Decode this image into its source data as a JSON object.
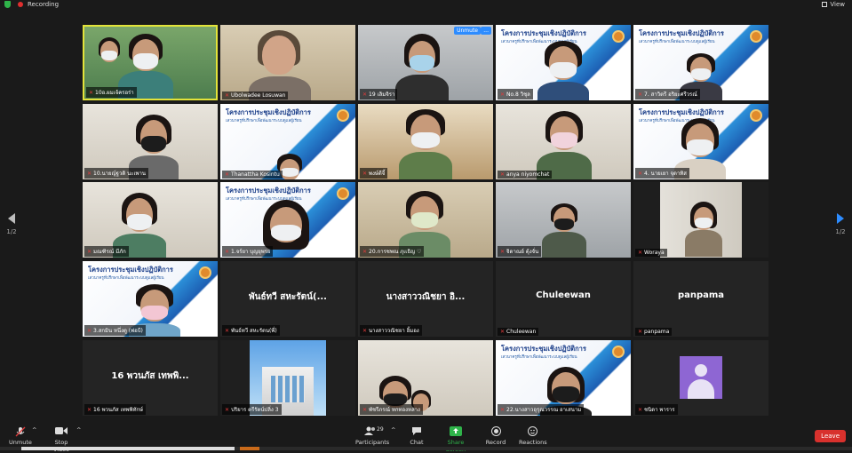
{
  "topbar": {
    "recording_label": "Recording",
    "view_label": "View"
  },
  "poster": {
    "title": "โครงการประชุมเชิงปฏิบัติการ",
    "subtitle": "เสวนาครูที่ปรึกษาเพื่อพัฒนาระบบดูแลผู้เรียน"
  },
  "tiles": {
    "t1": "10อ.ผมเจ้ครอร่า",
    "t2": "Ubolwadee Losuwan",
    "t3": "19 เลิมจิรา",
    "t4": "No.8 วิชุล",
    "t5": "7. สาวิตรี อริยะศรีวรณ์",
    "t6": "10.นายญ์ฐวดิ นะเพาน",
    "t7": "Thanattha Kosintu",
    "t8": "พงษ์ดีจี้",
    "t9": "anya niyomchat",
    "t10": "4. นายเยา จุดาทิส",
    "t11": "มณฑิรณ์ มีภัก",
    "t12": "1.จร์ยา บุญยุพรย",
    "t13": "20.การชพณ ภุเเธิญ ♡",
    "t14": "จิดาณย์ ตุ้งจั่น",
    "t15": "Woraya",
    "t16": "3.สกมิน หนึ่งตู (พ่อบี)",
    "t17": "พันธ์ทวี สหะรัตน(พี่)",
    "t17_big": "พันธ์ทวี สหะรัตน์(...",
    "t18": "นางสาววณิชยา อิ้มอง",
    "t18_big": "นางสาววณิชยา อิ...",
    "t19": "Chuleewan",
    "t19_big": "Chuleewan",
    "t20": "panpama",
    "t20_big": "panpama",
    "t21": "16 พวนภัส เทพพิทักษ์",
    "t21_big": "16 พวนภัส เทพพิ...",
    "t22": "ปริยาร ตรีรัตน์ปลิ่ง 3",
    "t23": "พัชรีภรณ์ หกทองหลาง",
    "t24": "22.นางสาวอุรุณวรรณ อาเสนาม",
    "t25": "ชนิดา พาราร"
  },
  "badges": {
    "unmute": "Unmute",
    "more": "..."
  },
  "pager": {
    "left": "1/2",
    "right": "1/2"
  },
  "toolbar": {
    "unmute": "Unmute",
    "stop_video": "Stop Video",
    "participants": "Participants",
    "participants_count": "29",
    "chat": "Chat",
    "share_screen": "Share Screen",
    "record": "Record",
    "reactions": "Reactions",
    "leave": "Leave"
  },
  "colors": {
    "leave": "#d8312d",
    "share": "#2fb34a",
    "accent": "#2d8cff",
    "active_speaker": "#e3e33a"
  }
}
